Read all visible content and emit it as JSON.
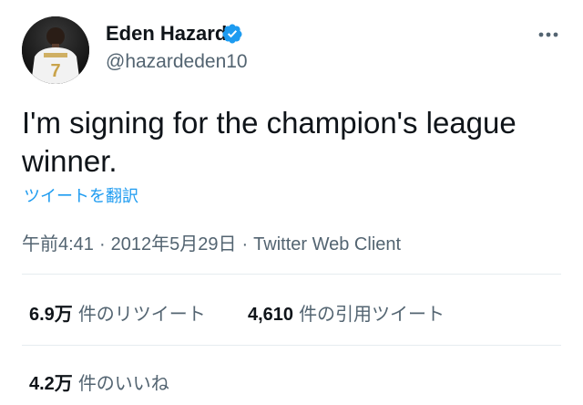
{
  "tweet": {
    "display_name": "Eden Hazard",
    "handle": "@hazardeden10",
    "text": "I'm signing for the champion's league winner.",
    "translate_label": "ツイートを翻訳",
    "time": "午前4:41",
    "separator": "·",
    "date": "2012年5月29日",
    "client": "Twitter Web Client"
  },
  "stats": {
    "retweets": {
      "value": "6.9万",
      "label": "件のリツイート"
    },
    "quotes": {
      "value": "4,610",
      "label": "件の引用ツイート"
    },
    "likes": {
      "value": "4.2万",
      "label": "件のいいね"
    }
  },
  "icons": {
    "verified": "verified-badge-icon",
    "more": "more-options-icon"
  },
  "colors": {
    "accent": "#1d9bf0",
    "text": "#0f1419",
    "secondary": "#536471",
    "divider": "#e6ecf0"
  }
}
